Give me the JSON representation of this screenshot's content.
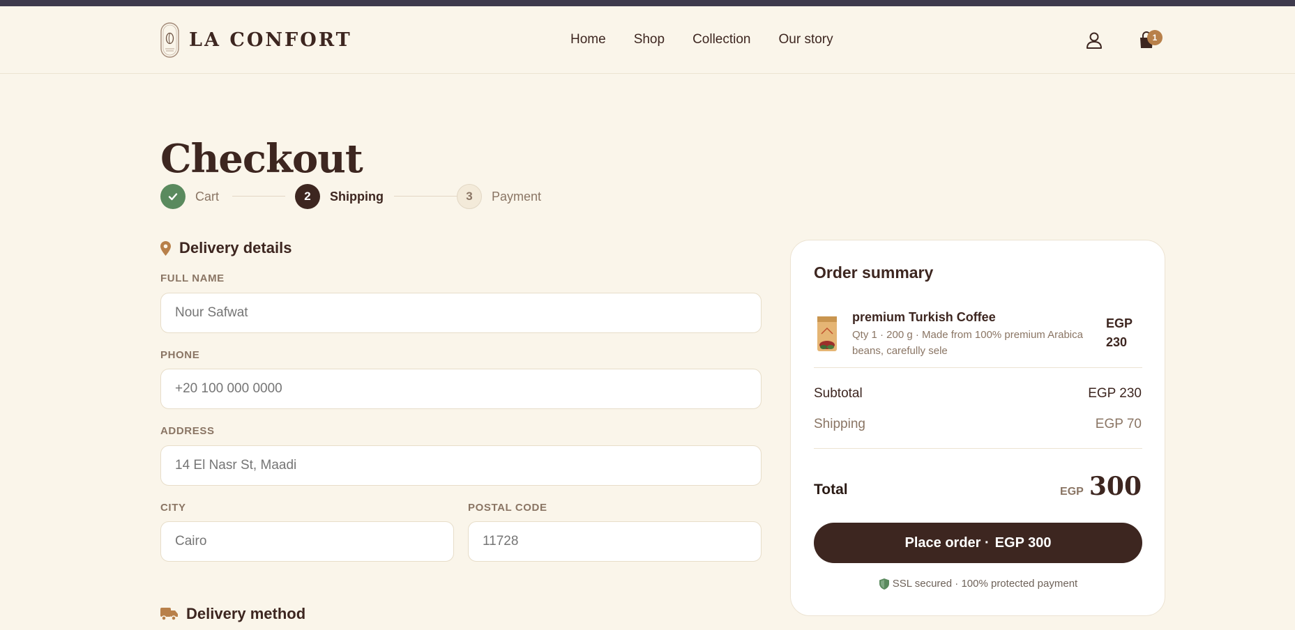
{
  "brand": {
    "name": "LA CONFORT"
  },
  "nav": {
    "items": [
      "Home",
      "Shop",
      "Collection",
      "Our story"
    ]
  },
  "cart": {
    "count": "1"
  },
  "checkout": {
    "title": "Checkout",
    "steps": [
      {
        "label": "Cart",
        "number": "1",
        "status": "done"
      },
      {
        "label": "Shipping",
        "number": "2",
        "status": "active"
      },
      {
        "label": "Payment",
        "number": "3",
        "status": "pending"
      }
    ]
  },
  "delivery": {
    "title": "Delivery details",
    "full_name": {
      "label": "FULL NAME",
      "placeholder": "Nour Safwat"
    },
    "phone": {
      "label": "PHONE",
      "placeholder": "+20 100 000 0000"
    },
    "address": {
      "label": "ADDRESS",
      "placeholder": "14 El Nasr St, Maadi"
    },
    "city": {
      "label": "CITY",
      "placeholder": "Cairo"
    },
    "postal": {
      "label": "POSTAL CODE",
      "placeholder": "11728"
    }
  },
  "delivery_method": {
    "title": "Delivery method"
  },
  "summary": {
    "title": "Order summary",
    "item": {
      "name": "premium Turkish Coffee",
      "desc": "Qty 1 · 200 g · Made from 100% premium Arabica beans, carefully sele",
      "price": "EGP 230"
    },
    "subtotal_label": "Subtotal",
    "subtotal_value": "EGP 230",
    "shipping_label": "Shipping",
    "shipping_value": "EGP 70",
    "total_label": "Total",
    "total_currency": "EGP",
    "total_value": "300",
    "place_order_label": "Place order ·",
    "place_order_amount": "EGP 300",
    "secure_text": "SSL secured · 100% protected payment"
  },
  "colors": {
    "background": "#faf5ea",
    "brand_dark": "#3d2620",
    "accent": "#b8804a",
    "success": "#5a8a5e"
  }
}
